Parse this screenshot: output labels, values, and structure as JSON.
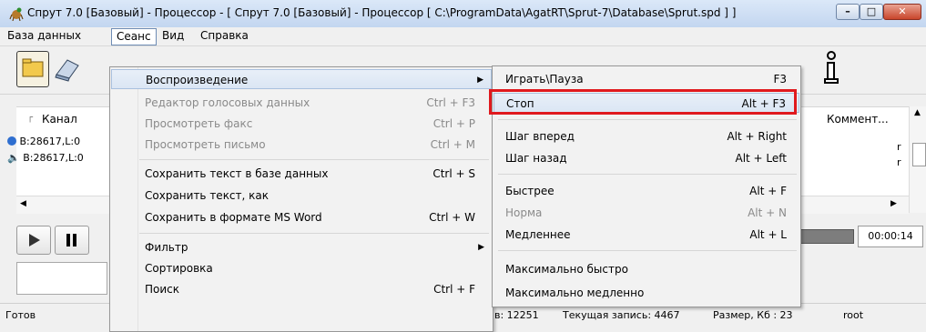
{
  "window": {
    "title": "Спрут 7.0 [Базовый] - Процессор - [ Спрут 7.0 [Базовый] - Процессор [ C:\\ProgramData\\AgatRT\\Sprut-7\\Database\\Sprut.spd ] ]",
    "min_glyph": "–",
    "max_glyph": "□",
    "close_glyph": "✕"
  },
  "menubar": {
    "items": [
      "База данных",
      "Сеанс",
      "Вид",
      "Справка"
    ]
  },
  "list": {
    "columns": [
      "Канал",
      "Коммент..."
    ],
    "rows": [
      "B:28617,L:0",
      "B:28617,L:0"
    ],
    "row_suffix": [
      "r",
      "r"
    ]
  },
  "player": {
    "time": "00:00:14"
  },
  "status": {
    "ready": "Готов",
    "total": "в: 12251",
    "current": "Текущая запись: 4467",
    "size": "Размер, Кб : 23",
    "user": "root"
  },
  "session_menu": {
    "items": [
      {
        "label": "Воспроизведение",
        "shortcut": "",
        "submenu": true,
        "state": "hover"
      },
      {
        "label": "Редактор голосовых данных",
        "shortcut": "Ctrl + F3",
        "state": "disabled"
      },
      {
        "label": "Просмотреть факс",
        "shortcut": "Ctrl + P",
        "state": "disabled"
      },
      {
        "label": "Просмотреть письмо",
        "shortcut": "Ctrl + M",
        "state": "disabled"
      },
      {
        "label": "Сохранить текст в базе данных",
        "shortcut": "Ctrl + S",
        "state": "normal"
      },
      {
        "label": "Сохранить текст, как",
        "shortcut": "",
        "state": "normal"
      },
      {
        "label": "Сохранить в формате MS Word",
        "shortcut": "Ctrl + W",
        "state": "normal"
      },
      {
        "label": "Фильтр",
        "shortcut": "",
        "submenu": true,
        "state": "normal"
      },
      {
        "label": "Сортировка",
        "shortcut": "",
        "state": "normal"
      },
      {
        "label": "Поиск",
        "shortcut": "Ctrl + F",
        "state": "normal"
      }
    ]
  },
  "playback_menu": {
    "items": [
      {
        "label": "Играть\\Пауза",
        "shortcut": "F3",
        "state": "normal"
      },
      {
        "label": "Стоп",
        "shortcut": "Alt + F3",
        "state": "hover",
        "highlighted": true
      },
      {
        "label": "Шаг вперед",
        "shortcut": "Alt + Right",
        "state": "normal"
      },
      {
        "label": "Шаг назад",
        "shortcut": "Alt + Left",
        "state": "normal"
      },
      {
        "label": "Быстрее",
        "shortcut": "Alt + F",
        "state": "normal"
      },
      {
        "label": "Норма",
        "shortcut": "Alt + N",
        "state": "disabled"
      },
      {
        "label": "Медленнее",
        "shortcut": "Alt + L",
        "state": "normal"
      },
      {
        "label": "Максимально быстро",
        "shortcut": "",
        "state": "normal"
      },
      {
        "label": "Максимально медленно",
        "shortcut": "",
        "state": "normal"
      }
    ]
  },
  "colors": {
    "highlight_box": "#e0191e",
    "menu_hover": "#dbe6f4"
  }
}
